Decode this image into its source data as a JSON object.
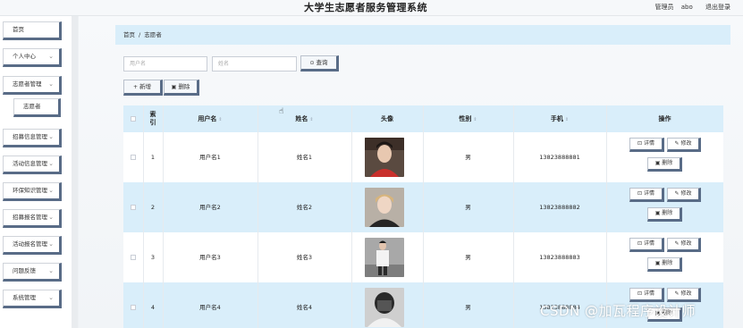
{
  "header": {
    "title": "大学生志愿者服务管理系统",
    "role": "管理员",
    "username": "abo",
    "logout": "退出登录"
  },
  "sidebar": {
    "items": [
      {
        "label": "首页",
        "has_arrow": false
      },
      {
        "label": "个人中心",
        "has_arrow": true
      },
      {
        "label": "志愿者管理",
        "has_arrow": true
      },
      {
        "label": "志愿者",
        "has_arrow": false,
        "sub": true
      },
      {
        "label": "招募信息管理",
        "has_arrow": true
      },
      {
        "label": "活动信息管理",
        "has_arrow": true
      },
      {
        "label": "环保知识管理",
        "has_arrow": true
      },
      {
        "label": "招募报名管理",
        "has_arrow": true
      },
      {
        "label": "活动报名管理",
        "has_arrow": true
      },
      {
        "label": "问题反馈",
        "has_arrow": true
      },
      {
        "label": "系统管理",
        "has_arrow": true
      }
    ]
  },
  "breadcrumb": {
    "home": "首页",
    "separator": "/",
    "current": "志愿者"
  },
  "search": {
    "username_placeholder": "用户名",
    "name_placeholder": "姓名",
    "query_label": "查询"
  },
  "toolbar": {
    "add_label": "新增",
    "delete_label": "删除"
  },
  "table": {
    "headers": {
      "index": "索引",
      "username": "用户名",
      "name": "姓名",
      "avatar": "头像",
      "gender": "性别",
      "phone": "手机",
      "actions": "操作"
    },
    "rows": [
      {
        "index": "1",
        "username": "用户名1",
        "name": "姓名1",
        "gender": "男",
        "phone": "13823888881"
      },
      {
        "index": "2",
        "username": "用户名2",
        "name": "姓名2",
        "gender": "男",
        "phone": "13823888882"
      },
      {
        "index": "3",
        "username": "用户名3",
        "name": "姓名3",
        "gender": "男",
        "phone": "13823888883"
      },
      {
        "index": "4",
        "username": "用户名4",
        "name": "姓名4",
        "gender": "男",
        "phone": "13823888884"
      }
    ],
    "actions": {
      "detail": "详情",
      "edit": "修改",
      "delete": "删除"
    }
  },
  "watermark": "CSDN @加瓦程序设计师",
  "colors": {
    "accent": "#596c87",
    "header_bg": "#d9eefa"
  }
}
